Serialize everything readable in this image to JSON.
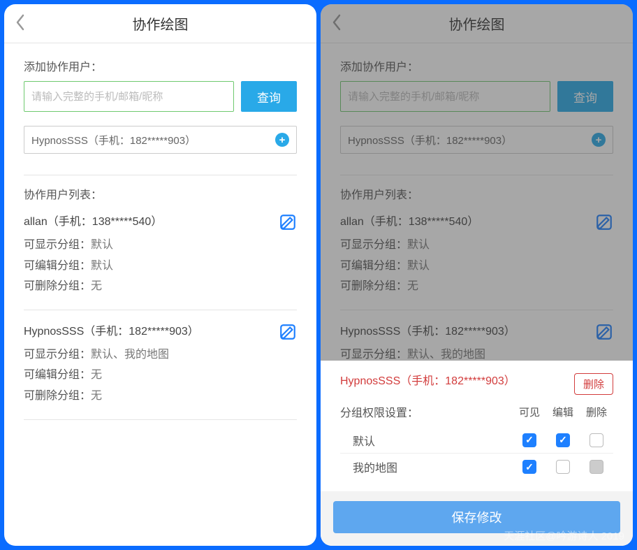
{
  "header": {
    "title": "协作绘图"
  },
  "add": {
    "label": "添加协作用户：",
    "placeholder": "请输入完整的手机/邮箱/昵称",
    "search_btn": "查询",
    "result": "HypnosSSS（手机：182*****903）"
  },
  "list": {
    "title": "协作用户列表：",
    "perm_labels": {
      "view": "可显示分组：",
      "edit": "可编辑分组：",
      "delete": "可删除分组："
    },
    "users": [
      {
        "name": "allan（手机：138*****540）",
        "view": "默认",
        "edit": "默认",
        "delete": "无"
      },
      {
        "name": "HypnosSSS（手机：182*****903）",
        "view": "默认、我的地图",
        "edit": "无",
        "delete": "无"
      }
    ]
  },
  "sheet": {
    "user": "HypnosSSS（手机：182*****903）",
    "delete_btn": "删除",
    "perm_title": "分组权限设置：",
    "cols": {
      "view": "可见",
      "edit": "编辑",
      "delete": "删除"
    },
    "groups": [
      {
        "name": "默认",
        "view": true,
        "edit": true,
        "delete": false,
        "delete_disabled": false
      },
      {
        "name": "我的地图",
        "view": true,
        "edit": false,
        "delete": false,
        "delete_disabled": true
      }
    ],
    "save_btn": "保存修改"
  },
  "watermark": "天涯社区@吟游诗人 2019"
}
